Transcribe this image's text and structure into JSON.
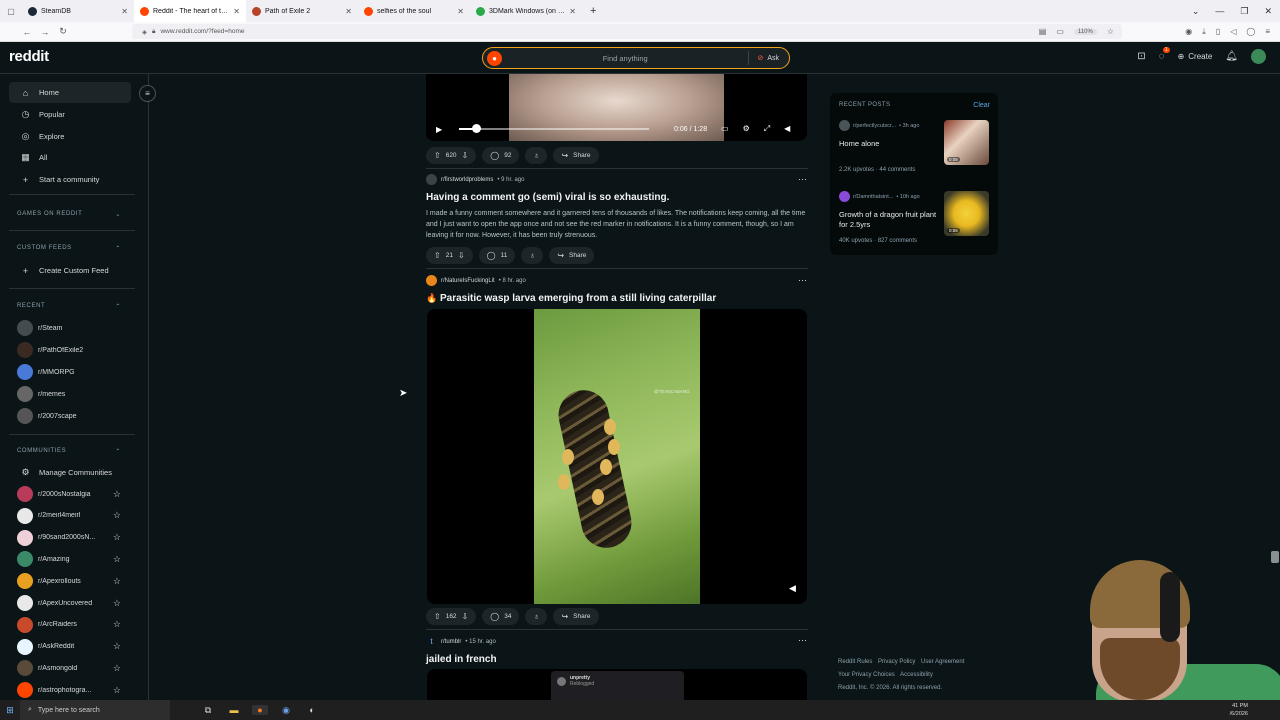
{
  "browser": {
    "tabs": [
      {
        "label": "SteamDB",
        "color": "#1b2838",
        "active": false
      },
      {
        "label": "Reddit - The heart of the internet",
        "color": "#ff4500",
        "active": true
      },
      {
        "label": "Path of Exile 2",
        "color": "#b8432a",
        "active": false
      },
      {
        "label": "selfies of the soul",
        "color": "#ff4500",
        "active": false
      },
      {
        "label": "3DMark Windows (on a) Phone",
        "color": "#2aa84a",
        "active": false
      }
    ],
    "url": "www.reddit.com/?feed=home",
    "zoom": "110%"
  },
  "header": {
    "logo": "reddit",
    "search_placeholder": "Find anything",
    "ask_label": "Ask",
    "create_label": "Create",
    "chat_badge": "1"
  },
  "sidebar": {
    "nav": [
      {
        "label": "Home",
        "icon": "home-icon",
        "glyph": "⌂"
      },
      {
        "label": "Popular",
        "icon": "popular-icon",
        "glyph": "◷"
      },
      {
        "label": "Explore",
        "icon": "explore-icon",
        "glyph": "◎"
      },
      {
        "label": "All",
        "icon": "all-icon",
        "glyph": "▦"
      },
      {
        "label": "Start a community",
        "icon": "plus-icon",
        "glyph": "+"
      }
    ],
    "games_heading": "GAMES ON REDDIT",
    "custom_feeds_heading": "CUSTOM FEEDS",
    "create_custom_feed": "Create Custom Feed",
    "recent_heading": "RECENT",
    "recent": [
      {
        "label": "r/Steam",
        "color": "#444c50"
      },
      {
        "label": "r/PathOfExile2",
        "color": "#3a2a22"
      },
      {
        "label": "r/MMORPG",
        "color": "#4a7ad8"
      },
      {
        "label": "r/memes",
        "color": "#666"
      },
      {
        "label": "r/2007scape",
        "color": "#555"
      }
    ],
    "communities_heading": "COMMUNITIES",
    "manage_communities": "Manage Communities",
    "communities": [
      {
        "label": "r/2000sNostalgia",
        "color": "#b83c5a"
      },
      {
        "label": "r/2meirl4meirl",
        "color": "#e8e8e8"
      },
      {
        "label": "r/90sand2000sN...",
        "color": "#f0d0d8"
      },
      {
        "label": "r/Amazing",
        "color": "#3a8a6a"
      },
      {
        "label": "r/Apexrollouts",
        "color": "#e8a020"
      },
      {
        "label": "r/ApexUncovered",
        "color": "#e8e8e8"
      },
      {
        "label": "r/ArcRaiders",
        "color": "#c84a2a"
      },
      {
        "label": "r/AskReddit",
        "color": "#e8f4ff"
      },
      {
        "label": "r/Asmongold",
        "color": "#5a4a3a"
      },
      {
        "label": "r/astrophotogra...",
        "color": "#ff4500"
      }
    ]
  },
  "feed": {
    "video1": {
      "time": "0:06 / 1:28",
      "progress": 0.09
    },
    "post1_actions": {
      "upvotes": "620",
      "comments": "92",
      "share": "Share"
    },
    "post2": {
      "subreddit": "r/firstworldproblems",
      "age": "• 9 hr. ago",
      "title": "Having a comment go (semi) viral is so exhausting.",
      "body": "I made a funny comment somewhere and it garnered tens of thousands of likes. The notifications keep coming, all the time and I just want to open the app once and not see the red marker in notifications. It is a funny comment, though, so I am leaving it for now. However, it has been truly strenuous.",
      "upvotes": "21",
      "comments": "11",
      "share": "Share"
    },
    "post3": {
      "subreddit": "r/NatureIsFuckingLit",
      "age": "• 8 hr. ago",
      "title_emoji": "🔥",
      "title": "Parasitic wasp larva emerging from a still living caterpillar",
      "watermark": "@TEANCABANG",
      "upvotes": "162",
      "comments": "34",
      "share": "Share"
    },
    "post4": {
      "subreddit": "r/tumblr",
      "age": "• 15 hr. ago",
      "title": "jailed in french",
      "card_user": "unpretty",
      "card_sub": "Reblogged"
    }
  },
  "recent_posts": {
    "heading": "RECENT POSTS",
    "clear": "Clear",
    "items": [
      {
        "sub": "r/perfectlycutscr...",
        "age": "• 3h ago",
        "title": "Home alone",
        "upvotes": "2.2K upvotes",
        "comments": "44 comments",
        "duration": "0:08"
      },
      {
        "sub": "r/Damnthatsint...",
        "age": "• 10h ago",
        "title": "Growth of a dragon fruit plant for 2.5yrs",
        "upvotes": "40K upvotes",
        "comments": "827 comments",
        "duration": "0:55"
      }
    ]
  },
  "footer": {
    "links": [
      "Reddit Rules",
      "Privacy Policy",
      "User Agreement",
      "Your Privacy Choices",
      "Accessibility"
    ],
    "copyright": "Reddit, Inc. © 2026. All rights reserved."
  },
  "taskbar": {
    "search_placeholder": "Type here to search",
    "time": "41 PM",
    "date": "/6/2026"
  }
}
